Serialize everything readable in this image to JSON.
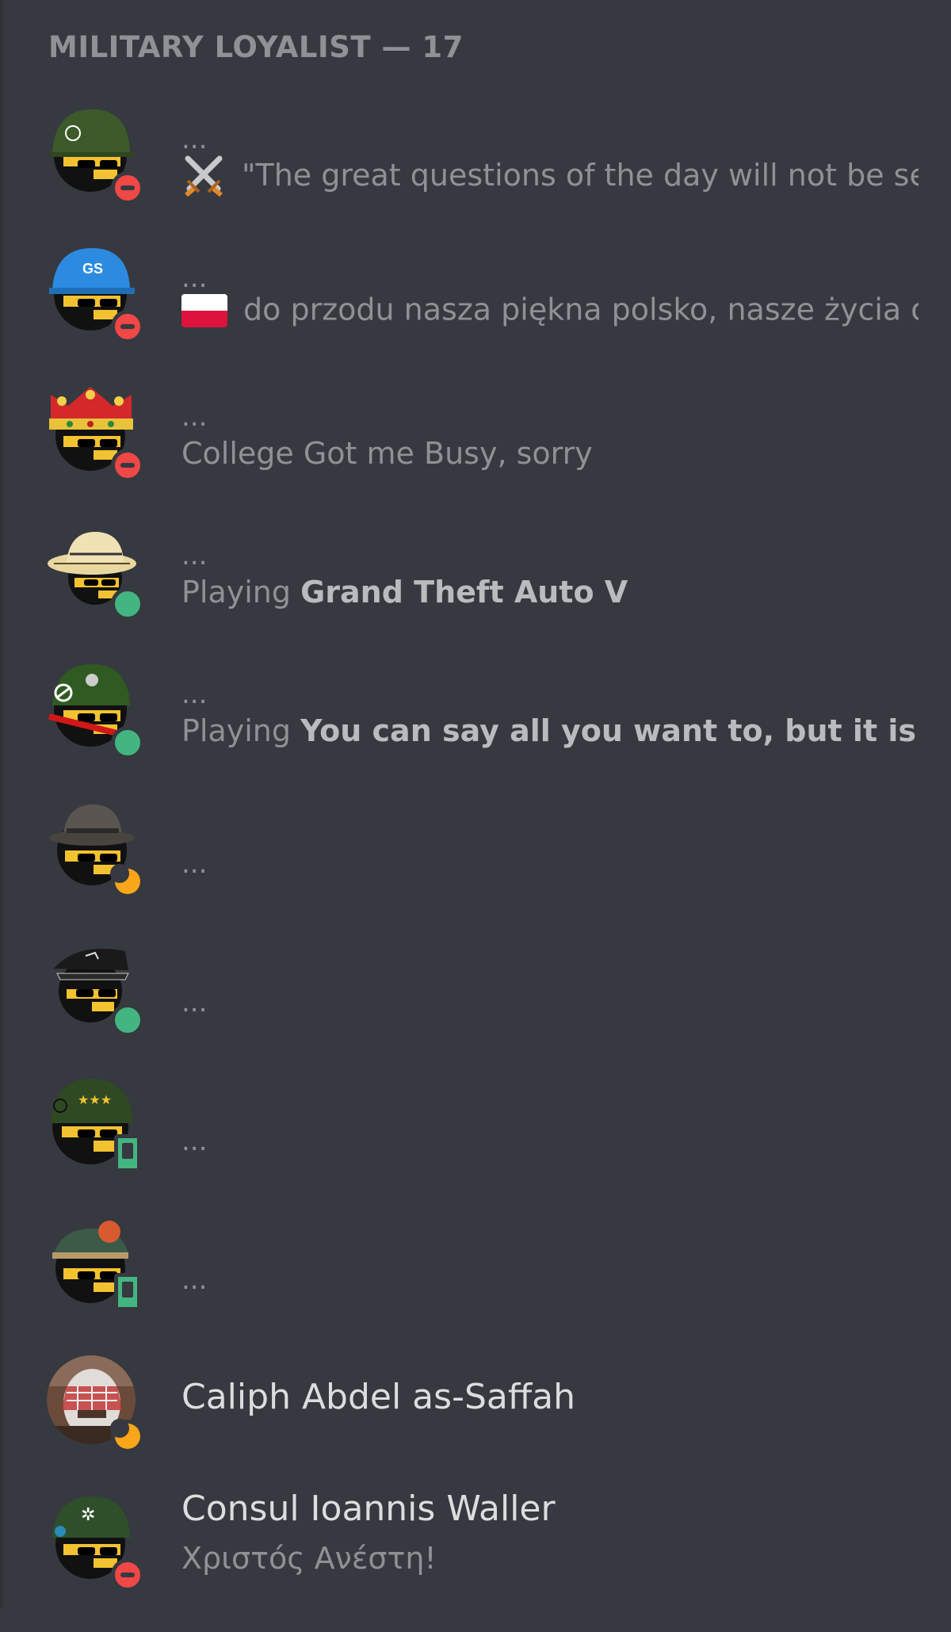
{
  "section": {
    "title": "MILITARY LOYALIST — 17"
  },
  "colors": {
    "background": "#36393f",
    "dnd": "#f04747",
    "online": "#43b581",
    "idle": "#faa61a",
    "muted_text": "#8e9297"
  },
  "members": [
    {
      "name": "...",
      "status": "dnd",
      "activity_icon": "crossed-swords-icon",
      "activity": "\"The great questions of the day will not be settl..."
    },
    {
      "name": "...",
      "status": "dnd",
      "activity_icon": "poland-flag-icon",
      "activity": "do przodu nasza piękna polsko, nasze życia od..."
    },
    {
      "name": "...",
      "status": "dnd",
      "activity": "College Got me Busy, sorry"
    },
    {
      "name": "...",
      "status": "online",
      "activity_prefix": "Playing",
      "activity_game": "Grand Theft Auto V"
    },
    {
      "name": "...",
      "status": "online",
      "activity_prefix": "Playing",
      "activity_game": "You can say all you want to, but it is action t..."
    },
    {
      "name": "...",
      "status": "idle"
    },
    {
      "name": "...",
      "status": "online"
    },
    {
      "name": "...",
      "status": "mobile"
    },
    {
      "name": "...",
      "status": "mobile"
    },
    {
      "name": "Caliph Abdel as-Saffah",
      "status": "idle"
    },
    {
      "name": "Consul Ioannis Waller",
      "status": "dnd",
      "activity": "Χριστός Ανέστη!"
    }
  ]
}
